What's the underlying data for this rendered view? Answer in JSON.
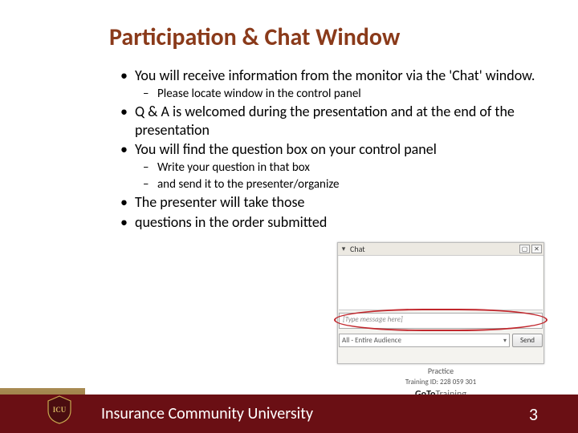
{
  "title": "Participation & Chat Window",
  "bullets": {
    "b1": "You will receive information from the monitor via the 'Chat' window.",
    "b1s1": "Please locate window in the control panel",
    "b2": "Q & A is welcomed during the presentation and at the end of the presentation",
    "b3": "You will find the question box on your control panel",
    "b3s1": "Write your question in that box",
    "b3s2": "and send it to the presenter/organize",
    "b4": "The presenter will take those",
    "b5": " questions in the order submitted"
  },
  "chat": {
    "header": "Chat",
    "close": "✕",
    "pop": "▢",
    "placeholder": "[Type message here]",
    "dropdown": "All - Entire Audience",
    "send": "Send"
  },
  "training": {
    "label": "Practice",
    "id": "Training ID: 228 059 301",
    "brand1": "GoTo",
    "brand2": "Training"
  },
  "footer": {
    "title": "Insurance Community University",
    "page": "3",
    "logo": "ICU"
  }
}
